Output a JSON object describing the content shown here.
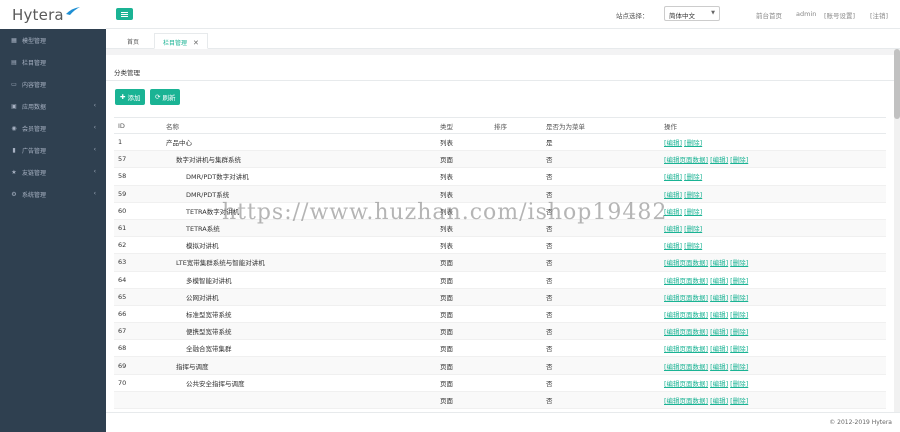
{
  "brand": {
    "logo_text": "Hytera",
    "accent": "#1ab394",
    "sidebar_bg": "#2f4050"
  },
  "sidebar": {
    "items": [
      {
        "label": "模型管理",
        "icon": "dashboard-icon",
        "has_arrow": false
      },
      {
        "label": "栏目管理",
        "icon": "columns-icon",
        "has_arrow": false
      },
      {
        "label": "内容管理",
        "icon": "document-icon",
        "has_arrow": false
      },
      {
        "label": "应用数据",
        "icon": "briefcase-icon",
        "has_arrow": true
      },
      {
        "label": "会员管理",
        "icon": "user-icon",
        "has_arrow": true
      },
      {
        "label": "广告管理",
        "icon": "chart-icon",
        "has_arrow": true
      },
      {
        "label": "友链管理",
        "icon": "star-icon",
        "has_arrow": true
      },
      {
        "label": "系统管理",
        "icon": "gear-icon",
        "has_arrow": true
      }
    ]
  },
  "header": {
    "site_label": "站点选择：",
    "site_value": "简体中文",
    "links": [
      "前台首页",
      "admin",
      "[账号设置]",
      "[注销]"
    ]
  },
  "tabs": [
    {
      "label": "首页",
      "active": false
    },
    {
      "label": "栏目管理",
      "active": true,
      "close": "✕"
    }
  ],
  "panel": {
    "title": "分类管理",
    "add_button": "添加",
    "refresh_button": "刷新"
  },
  "table": {
    "headers": [
      "ID",
      "名称",
      "类型",
      "排序",
      "是否为为菜单",
      "操作"
    ],
    "rows": [
      {
        "id": "1",
        "name": "产品中心",
        "indent": 0,
        "type": "列表",
        "sort": "",
        "menu": "是",
        "ops": [
          "[编辑]",
          "[删除]"
        ]
      },
      {
        "id": "57",
        "name": "数字对讲机与集群系统",
        "indent": 1,
        "type": "页面",
        "sort": "",
        "menu": "否",
        "ops": [
          "[编辑页面数据]",
          "[编辑]",
          "[删除]"
        ]
      },
      {
        "id": "58",
        "name": "DMR/PDT数字对讲机",
        "indent": 2,
        "type": "列表",
        "sort": "",
        "menu": "否",
        "ops": [
          "[编辑]",
          "[删除]"
        ]
      },
      {
        "id": "59",
        "name": "DMR/PDT系统",
        "indent": 2,
        "type": "列表",
        "sort": "",
        "menu": "否",
        "ops": [
          "[编辑]",
          "[删除]"
        ]
      },
      {
        "id": "60",
        "name": "TETRA数字对讲机",
        "indent": 2,
        "type": "列表",
        "sort": "",
        "menu": "否",
        "ops": [
          "[编辑]",
          "[删除]"
        ]
      },
      {
        "id": "61",
        "name": "TETRA系统",
        "indent": 2,
        "type": "列表",
        "sort": "",
        "menu": "否",
        "ops": [
          "[编辑]",
          "[删除]"
        ]
      },
      {
        "id": "62",
        "name": "模拟对讲机",
        "indent": 2,
        "type": "列表",
        "sort": "",
        "menu": "否",
        "ops": [
          "[编辑]",
          "[删除]"
        ]
      },
      {
        "id": "63",
        "name": "LTE宽带集群系统与智能对讲机",
        "indent": 1,
        "type": "页面",
        "sort": "",
        "menu": "否",
        "ops": [
          "[编辑页面数据]",
          "[编辑]",
          "[删除]"
        ]
      },
      {
        "id": "64",
        "name": "多模智能对讲机",
        "indent": 2,
        "type": "页面",
        "sort": "",
        "menu": "否",
        "ops": [
          "[编辑页面数据]",
          "[编辑]",
          "[删除]"
        ]
      },
      {
        "id": "65",
        "name": "公网对讲机",
        "indent": 2,
        "type": "页面",
        "sort": "",
        "menu": "否",
        "ops": [
          "[编辑页面数据]",
          "[编辑]",
          "[删除]"
        ]
      },
      {
        "id": "66",
        "name": "标准型宽带系统",
        "indent": 2,
        "type": "页面",
        "sort": "",
        "menu": "否",
        "ops": [
          "[编辑页面数据]",
          "[编辑]",
          "[删除]"
        ]
      },
      {
        "id": "67",
        "name": "便携型宽带系统",
        "indent": 2,
        "type": "页面",
        "sort": "",
        "menu": "否",
        "ops": [
          "[编辑页面数据]",
          "[编辑]",
          "[删除]"
        ]
      },
      {
        "id": "68",
        "name": "全融合宽带集群",
        "indent": 2,
        "type": "页面",
        "sort": "",
        "menu": "否",
        "ops": [
          "[编辑页面数据]",
          "[编辑]",
          "[删除]"
        ]
      },
      {
        "id": "69",
        "name": "指挥与调度",
        "indent": 1,
        "type": "页面",
        "sort": "",
        "menu": "否",
        "ops": [
          "[编辑页面数据]",
          "[编辑]",
          "[删除]"
        ]
      },
      {
        "id": "70",
        "name": "公共安全指挥与调度",
        "indent": 2,
        "type": "页面",
        "sort": "",
        "menu": "否",
        "ops": [
          "[编辑页面数据]",
          "[编辑]",
          "[删除]"
        ]
      },
      {
        "id": "",
        "name": "",
        "indent": 2,
        "type": "页面",
        "sort": "",
        "menu": "否",
        "ops": [
          "[编辑页面数据]",
          "[编辑]",
          "[删除]"
        ]
      }
    ]
  },
  "watermark": "https://www.huzhan.com/ishop19482",
  "footer": {
    "copyright": "© 2012-2019 Hytera"
  }
}
